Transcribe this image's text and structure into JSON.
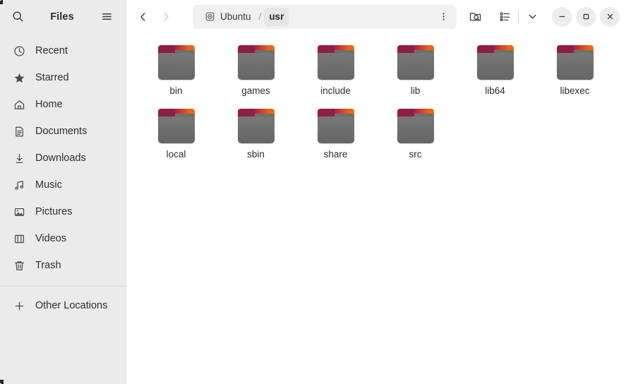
{
  "window": {
    "app_title": "Files",
    "background": "#ffffff"
  },
  "sidebar": {
    "title": "Files",
    "search_icon": "search-icon",
    "menu_icon": "hamburger-menu-icon",
    "background": "#ebebeb",
    "items": [
      {
        "label": "Recent",
        "icon": "clock-icon"
      },
      {
        "label": "Starred",
        "icon": "star-icon"
      },
      {
        "label": "Home",
        "icon": "home-icon"
      },
      {
        "label": "Documents",
        "icon": "document-icon"
      },
      {
        "label": "Downloads",
        "icon": "download-arrow-icon"
      },
      {
        "label": "Music",
        "icon": "music-note-icon"
      },
      {
        "label": "Pictures",
        "icon": "picture-icon"
      },
      {
        "label": "Videos",
        "icon": "video-film-icon"
      },
      {
        "label": "Trash",
        "icon": "trash-icon"
      }
    ],
    "other_locations": {
      "label": "Other Locations",
      "icon": "plus-icon"
    }
  },
  "headerbar": {
    "back_label": "‹",
    "forward_label": "›",
    "back_enabled": true,
    "forward_enabled": false,
    "pathbar": {
      "background": "#f1f1f1",
      "crumbs": [
        {
          "label": "Ubuntu",
          "icon": "disk-drive-icon",
          "current": false
        },
        {
          "label": "usr",
          "icon": "",
          "current": true
        }
      ],
      "separator": "/",
      "menu_icon": "vertical-dots-icon"
    },
    "search_button_icon": "folder-search-icon",
    "view_list_icon": "list-view-icon",
    "view_dropdown_icon": "chevron-down-icon",
    "window_controls": [
      {
        "name": "minimize",
        "glyph": "—"
      },
      {
        "name": "maximize",
        "glyph": "□"
      },
      {
        "name": "close",
        "glyph": "✕"
      }
    ]
  },
  "content": {
    "view_mode": "icon-grid",
    "folder_colors": {
      "tab": "#8e1f42",
      "accent": "#f06a15",
      "body": "#6e6e6e"
    },
    "files": [
      {
        "name": "bin",
        "type": "folder"
      },
      {
        "name": "games",
        "type": "folder"
      },
      {
        "name": "include",
        "type": "folder"
      },
      {
        "name": "lib",
        "type": "folder"
      },
      {
        "name": "lib64",
        "type": "folder"
      },
      {
        "name": "libexec",
        "type": "folder"
      },
      {
        "name": "local",
        "type": "folder"
      },
      {
        "name": "sbin",
        "type": "folder"
      },
      {
        "name": "share",
        "type": "folder"
      },
      {
        "name": "src",
        "type": "folder"
      }
    ]
  }
}
